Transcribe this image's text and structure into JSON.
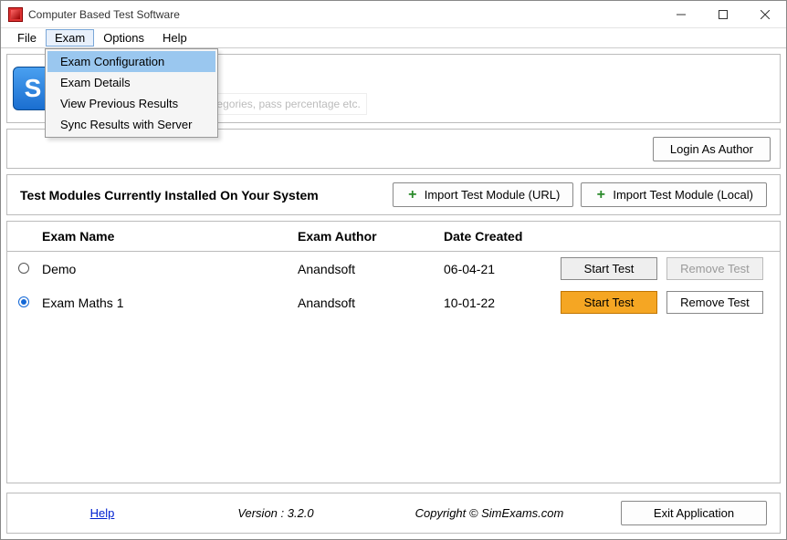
{
  "titlebar": {
    "title": "Computer Based Test Software"
  },
  "menubar": {
    "items": [
      "File",
      "Exam",
      "Options",
      "Help"
    ],
    "active_index": 1,
    "dropdown": {
      "items": [
        "Exam Configuration",
        "Exam Details",
        "View Previous Results",
        "Sync Results with Server"
      ],
      "highlight_index": 0
    }
  },
  "banner": {
    "logo_letter": "S",
    "tm": "™",
    "hint_text": "e number of questions, categories, pass percentage etc."
  },
  "login": {
    "button": "Login As Author"
  },
  "modules_header": {
    "label": "Test Modules Currently Installed On Your System",
    "import_url": "Import Test Module (URL)",
    "import_local": "Import Test Module (Local)"
  },
  "table": {
    "columns": {
      "name": "Exam Name",
      "author": "Exam Author",
      "date": "Date Created"
    },
    "rows": [
      {
        "selected": false,
        "name": "Demo",
        "author": "Anandsoft",
        "date": "06-04-21",
        "start_label": "Start Test",
        "remove_label": "Remove Test",
        "start_style": "default",
        "remove_disabled": true
      },
      {
        "selected": true,
        "name": "Exam Maths 1",
        "author": "Anandsoft",
        "date": "10-01-22",
        "start_label": "Start Test",
        "remove_label": "Remove Test",
        "start_style": "orange",
        "remove_disabled": false
      }
    ]
  },
  "footer": {
    "help": "Help",
    "version": "Version : 3.2.0",
    "copyright": "Copyright © SimExams.com",
    "exit": "Exit Application"
  }
}
